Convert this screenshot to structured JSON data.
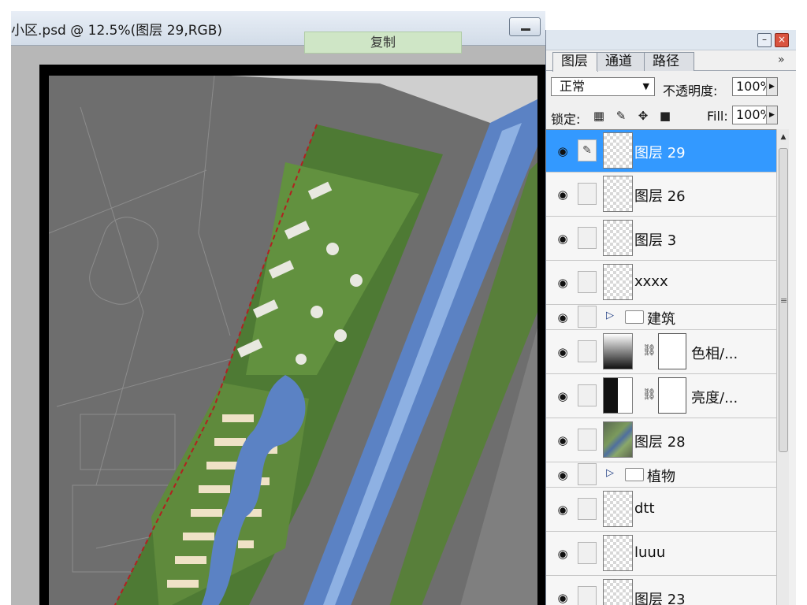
{
  "document": {
    "title": "小区.psd @ 12.5%(图层 29,RGB)",
    "tooltip": "复制"
  },
  "panel": {
    "tabs": [
      {
        "label": "图层",
        "active": true
      },
      {
        "label": "通道",
        "active": false
      },
      {
        "label": "路径",
        "active": false
      }
    ],
    "menu_icon": "»",
    "blend_mode": "正常",
    "opacity_label": "不透明度:",
    "opacity_value": "100%",
    "lock_label": "锁定:",
    "fill_label": "Fill:",
    "fill_value": "100%",
    "layers": [
      {
        "name": "图层 29",
        "kind": "pixel",
        "selected": true,
        "visible": true,
        "brush": true
      },
      {
        "name": "图层 26",
        "kind": "pixel",
        "selected": false,
        "visible": true
      },
      {
        "name": "图层 3",
        "kind": "pixel",
        "selected": false,
        "visible": true
      },
      {
        "name": "xxxx",
        "kind": "pixel",
        "selected": false,
        "visible": true
      },
      {
        "name": "建筑",
        "kind": "group",
        "selected": false,
        "visible": true
      },
      {
        "name": "色相/...",
        "kind": "adjustment-hue",
        "selected": false,
        "visible": true
      },
      {
        "name": "亮度/...",
        "kind": "adjustment-brightness",
        "selected": false,
        "visible": true
      },
      {
        "name": "图层 28",
        "kind": "pixel-map",
        "selected": false,
        "visible": true
      },
      {
        "name": "植物",
        "kind": "group",
        "selected": false,
        "visible": true
      },
      {
        "name": "dtt",
        "kind": "pixel",
        "selected": false,
        "visible": true
      },
      {
        "name": "luuu",
        "kind": "pixel",
        "selected": false,
        "visible": true
      },
      {
        "name": "图层 23",
        "kind": "pixel",
        "selected": false,
        "visible": true
      }
    ]
  },
  "colors": {
    "selected": "#3399ff",
    "water": "#5b82c4",
    "green": "#5f8a3c"
  }
}
